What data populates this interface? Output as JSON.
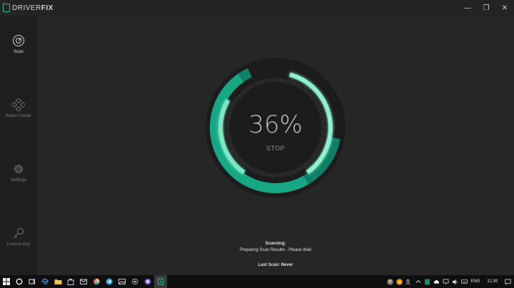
{
  "app": {
    "logo_prefix": "DRIVER",
    "logo_suffix": "FIX",
    "brand_color": "#27c08b"
  },
  "window_controls": {
    "minimize": "—",
    "maximize": "❐",
    "close": "✕"
  },
  "sidebar": {
    "items": [
      {
        "label": "Scan",
        "icon": "scan-icon",
        "active": true
      },
      {
        "label": "Action Center",
        "icon": "action-center-icon",
        "active": false
      },
      {
        "label": "Settings",
        "icon": "gear-icon",
        "active": false
      },
      {
        "label": "License Key",
        "icon": "key-icon",
        "active": false
      }
    ]
  },
  "scan": {
    "progress_text": "36%",
    "progress": 0.36,
    "stop_label": "STOP",
    "status_title": "Scanning:",
    "status_detail": "Preparing Scan Results - Please Wait",
    "last_scan": "Last Scan: Never"
  },
  "taskbar": {
    "language": "ENG",
    "time": "11:39"
  }
}
